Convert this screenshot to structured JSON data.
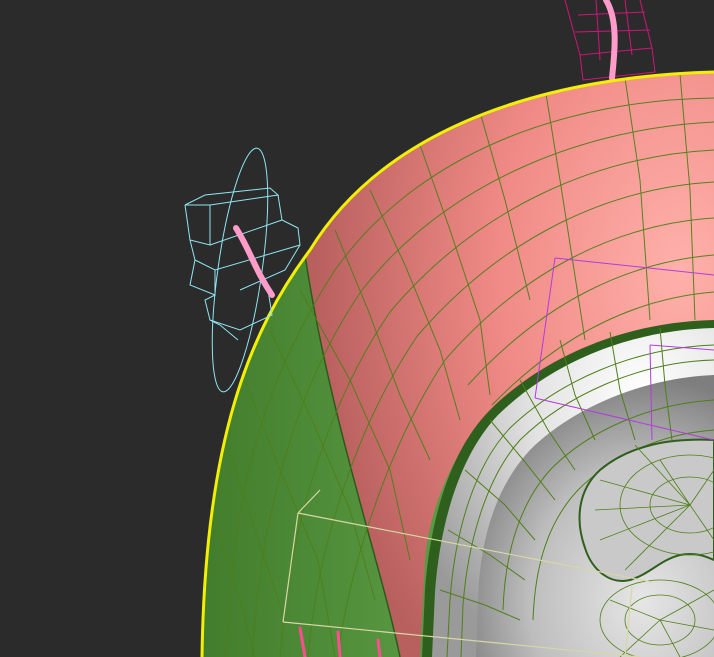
{
  "viewport": {
    "background": "#2b2b2b",
    "selection_color": "#f2f000",
    "wire_color": "#4f7f19"
  },
  "scene": {
    "objects": [
      {
        "name": "outer-shell",
        "material_colors": [
          "#f08a86",
          "#5d9c46"
        ]
      },
      {
        "name": "inner-cup",
        "material_colors": [
          "#d8d8d8",
          "#9b9b9b"
        ]
      },
      {
        "name": "bone-helper-left",
        "color": "#8fe6f2"
      },
      {
        "name": "bone-helper-top",
        "color": "#ff2a86"
      },
      {
        "name": "gizmo-box",
        "color": "#d7d7a8"
      },
      {
        "name": "bounding-box",
        "color": "#b23be0"
      }
    ]
  }
}
